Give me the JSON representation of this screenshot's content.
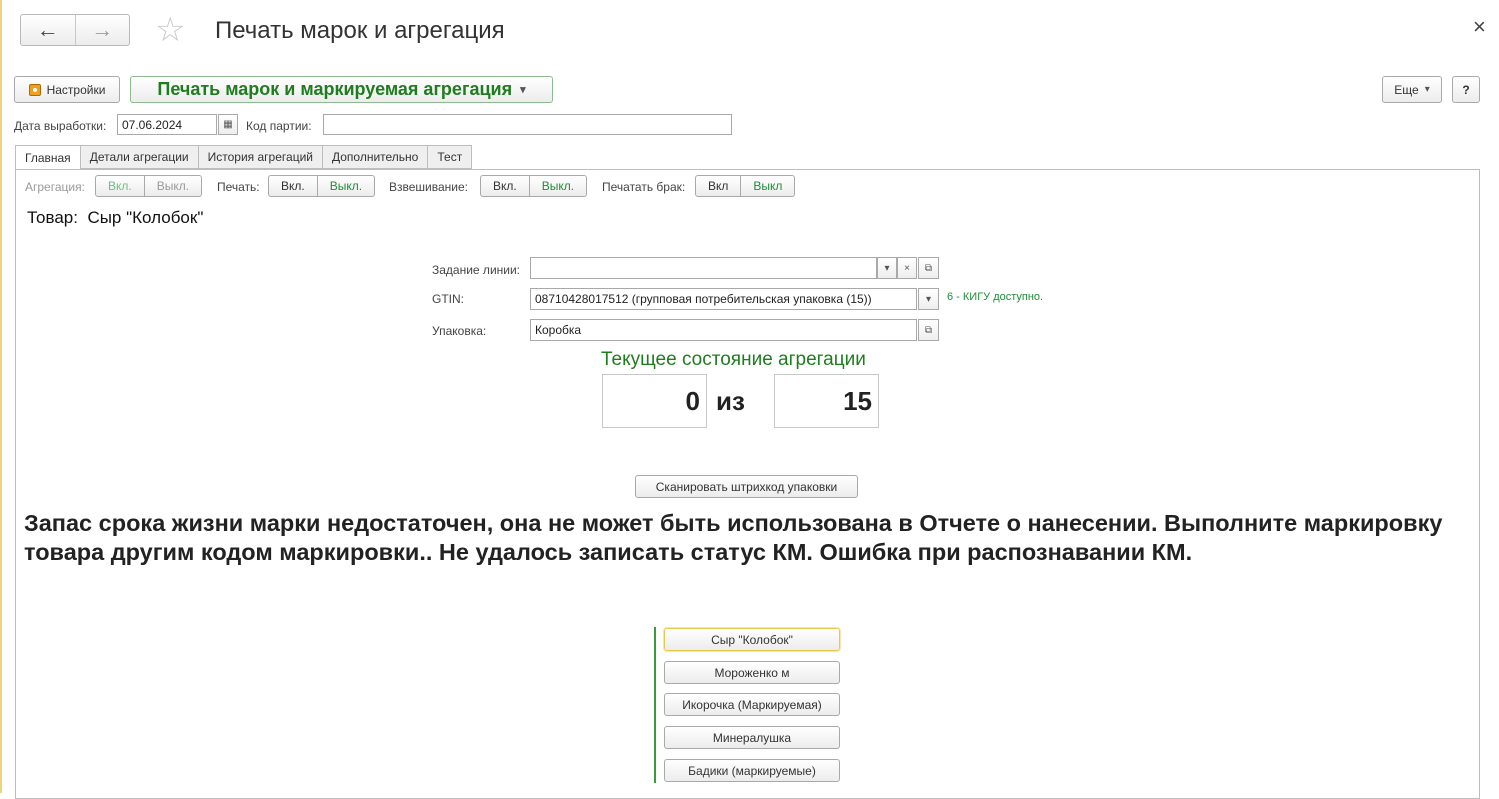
{
  "window": {
    "title": "Печать марок и агрегация",
    "close": "×"
  },
  "nav": {
    "back": "←",
    "forward": "→"
  },
  "toolbar": {
    "settings_label": "Настройки",
    "mode_label": "Печать марок и маркируемая агрегация",
    "more_label": "Еще",
    "help_label": "?"
  },
  "fields": {
    "date_label": "Дата выработки:",
    "date_value": "07.06.2024",
    "batch_label": "Код партии:",
    "batch_value": ""
  },
  "tabs": [
    "Главная",
    "Детали агрегации",
    "История агрегаций",
    "Дополнительно",
    "Тест"
  ],
  "toggles": {
    "aggregation": {
      "label": "Агрегация:",
      "on": "Вкл.",
      "off": "Выкл."
    },
    "print": {
      "label": "Печать:",
      "on": "Вкл.",
      "off": "Выкл."
    },
    "weighing": {
      "label": "Взвешивание:",
      "on": "Вкл.",
      "off": "Выкл."
    },
    "print_defect": {
      "label": "Печатать брак:",
      "on": "Вкл",
      "off": "Выкл"
    }
  },
  "product": {
    "label": "Товар:",
    "name": "Сыр \"Колобок\""
  },
  "form": {
    "line_task_label": "Задание линии:",
    "line_task_value": "",
    "gtin_label": "GTIN:",
    "gtin_value": "08710428017512 (групповая потребительская упаковка (15))",
    "gtin_note": "6 - КИГУ доступно.",
    "package_label": "Упаковка:",
    "package_value": "Коробка"
  },
  "aggregation_state": {
    "title": "Текущее состояние агрегации",
    "current": "0",
    "separator": "из",
    "total": "15"
  },
  "scan_button": "Сканировать штрихкод упаковки",
  "message": "Запас срока жизни марки недостаточен, она не может быть использована в Отчете о нанесении. Выполните маркировку товара другим кодом маркировки.. Не удалось записать статус КМ. Ошибка при распознавании КМ.",
  "product_buttons": [
    "Сыр \"Колобок\"",
    "Мороженко м",
    "Икорочка (Маркируемая)",
    "Минералушка",
    "Бадики (маркируемые)"
  ],
  "icons": {
    "dropdown": "▾",
    "clear": "×",
    "open": "⧉",
    "calendar": "▦",
    "star": "☆"
  }
}
